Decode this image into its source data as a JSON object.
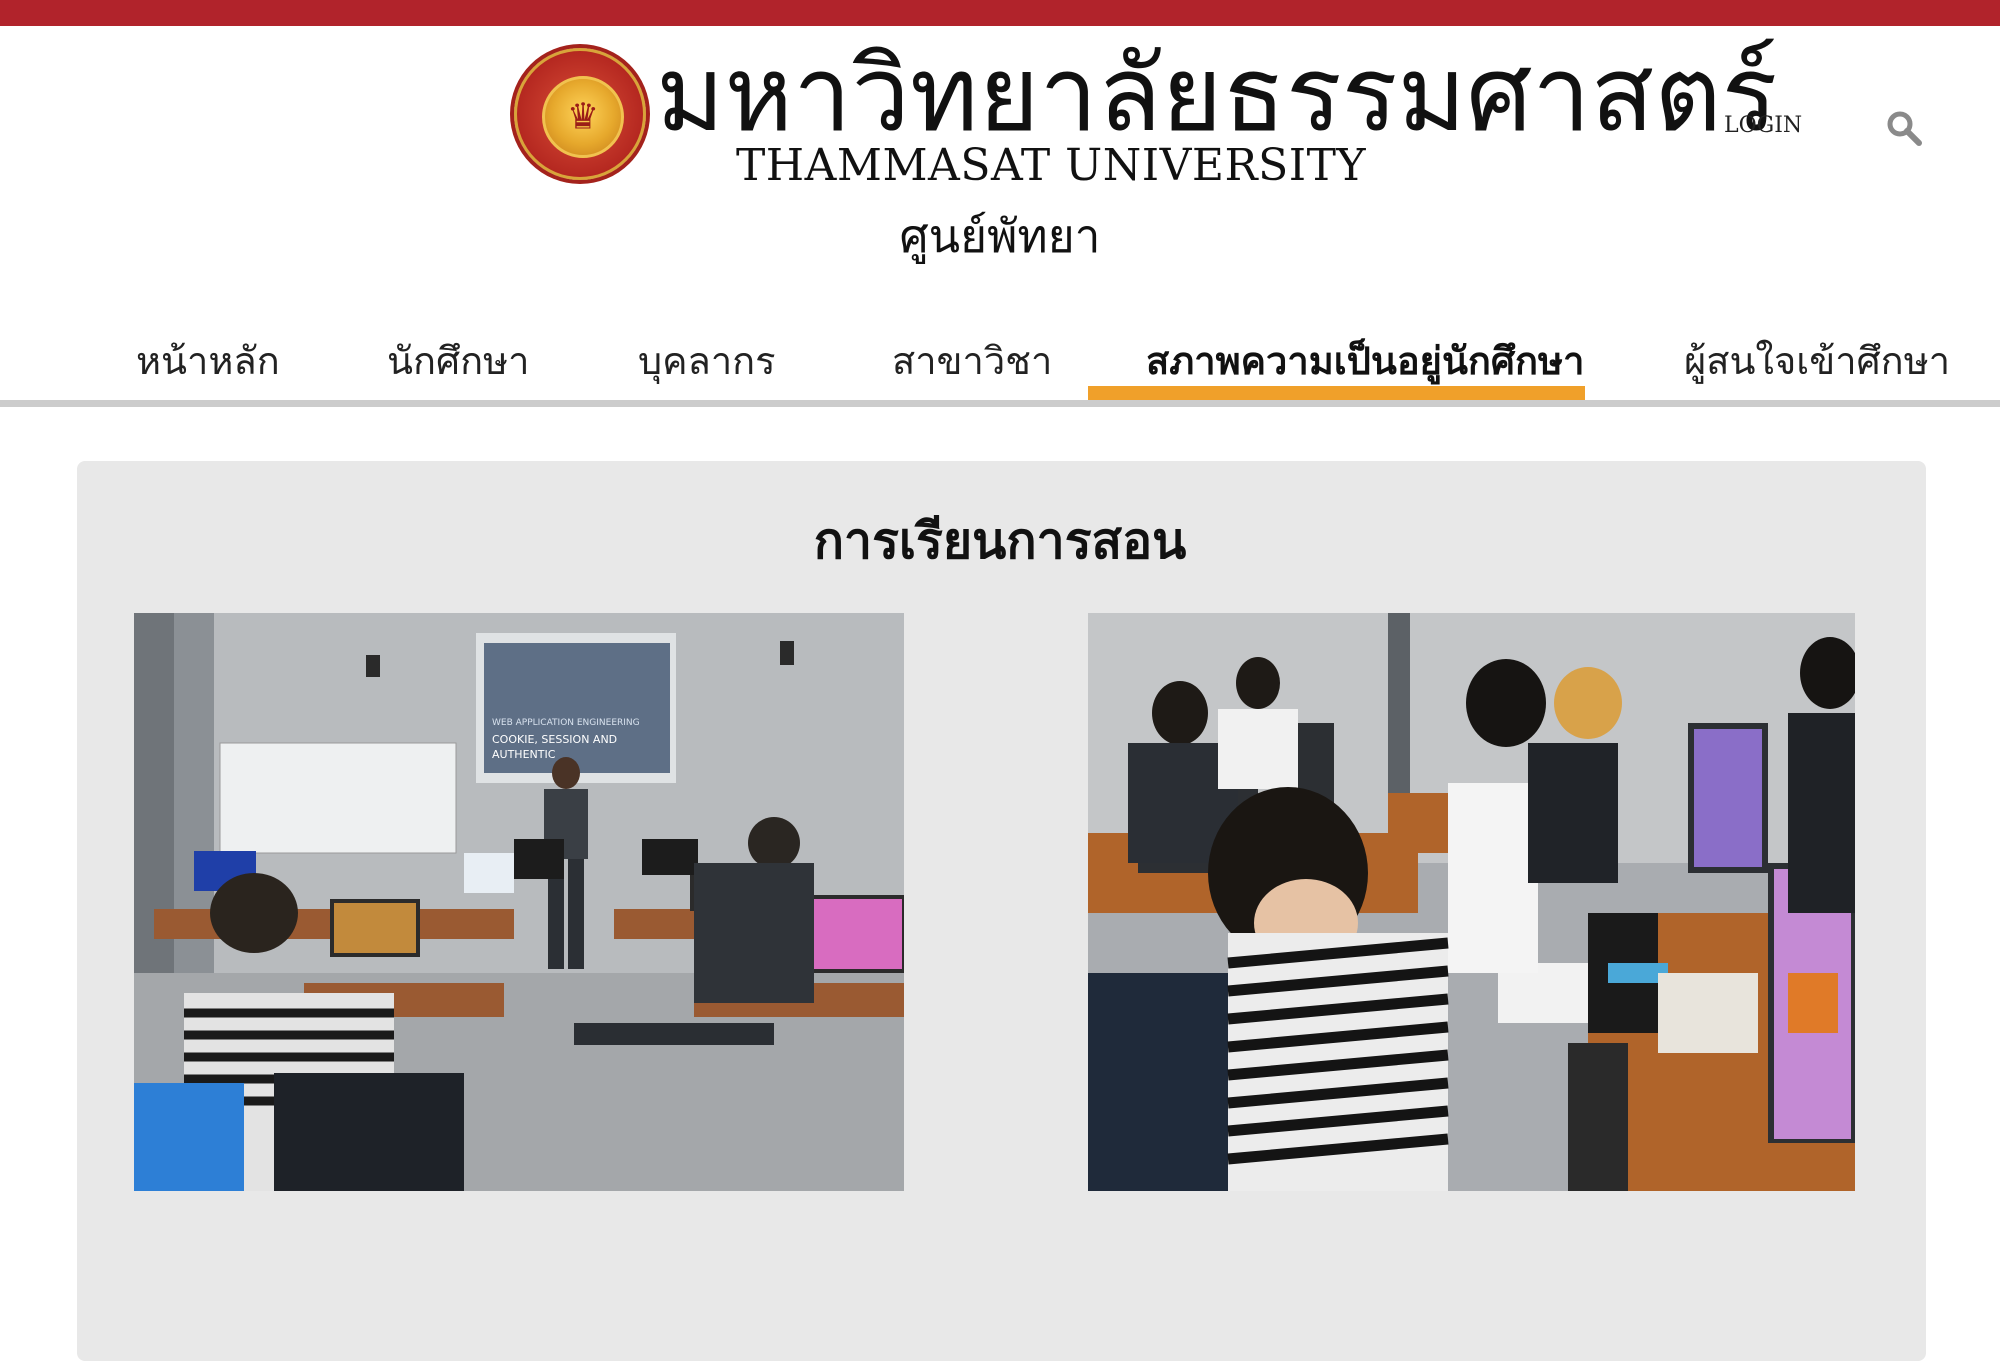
{
  "header": {
    "university_thai": "มหาวิทยาลัยธรรมศาสตร์",
    "university_en": "THAMMASAT UNIVERSITY",
    "seal_text": "THAMMASAT UNIVERSITY",
    "campus": "ศูนย์พัทยา",
    "login_label": "LOGIN",
    "search_icon": "search-icon"
  },
  "nav": {
    "items": [
      {
        "label": "หน้าหลัก",
        "active": false
      },
      {
        "label": "นักศึกษา",
        "active": false
      },
      {
        "label": "บุคลากร",
        "active": false
      },
      {
        "label": "สาขาวิชา",
        "active": false
      },
      {
        "label": "สภาพความเป็นอยู่นักศึกษา",
        "active": true
      },
      {
        "label": "ผู้สนใจเข้าศึกษา",
        "active": false
      }
    ]
  },
  "section": {
    "title": "การเรียนการสอน",
    "photos": [
      {
        "subject": "classroom lecture",
        "slide_lines": [
          "WEB APPLICATION ENGINEERING",
          "COOKIE, SESSION AND",
          "AUTHENTIC"
        ]
      },
      {
        "subject": "students at computers"
      }
    ]
  },
  "colors": {
    "top_bar": "#b1232b",
    "active_underline": "#f0a02a",
    "nav_rule": "#cccccc",
    "panel_bg": "#e8e8e8"
  }
}
